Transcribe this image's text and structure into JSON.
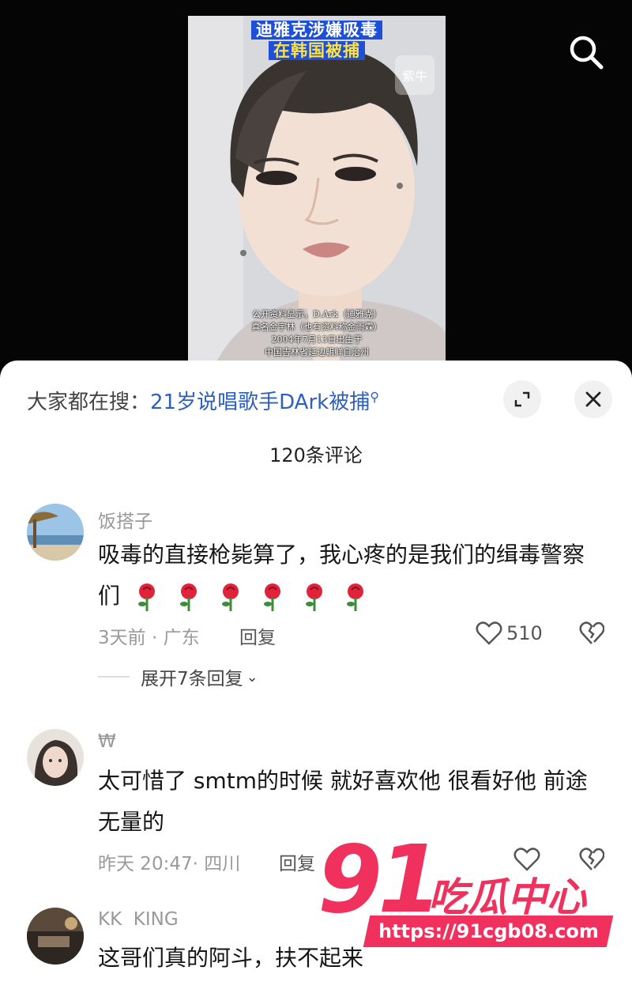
{
  "video": {
    "title_line1": "迪雅克涉嫌吸毒",
    "title_line2": "在韩国被捕",
    "logo_text": "紫牛",
    "caption_lines": [
      "公开资料显示，D.Ark（迪雅克）",
      "真名金宇林（也有资料称金雨霖）",
      "2004年7月13日出生于",
      "中国吉林省延边朝鲜自治州"
    ]
  },
  "top_bar": {
    "search_icon": "search-icon"
  },
  "search_hint": {
    "prefix": "大家都在搜：",
    "term": "21岁说唱歌手DArk被捕",
    "suffix_icon": "⚲"
  },
  "sheet_buttons": {
    "expand_icon": "expand-icon",
    "close_icon": "close-icon"
  },
  "comments_header": {
    "count_label": "120条评论"
  },
  "comments": [
    {
      "name": "饭搭子",
      "text": "吸毒的直接枪毙算了，我心疼的是我们的缉毒警察们",
      "rose_count": 6,
      "time": "3天前",
      "location": "广东",
      "reply_label": "回复",
      "likes": "510",
      "expand_label": "展开7条回复"
    },
    {
      "name": "₩",
      "text": "太可惜了 smtm的时候 就好喜欢他 很看好他 前途无量的",
      "time": "昨天 20:47",
      "location": "四川",
      "reply_label": "回复"
    },
    {
      "name": "KK  KING",
      "text": "这哥们真的阿斗，扶不起来"
    }
  ],
  "watermark": {
    "number": "91",
    "brand": "吃瓜中心",
    "url": "https://91cgb08.com"
  },
  "colors": {
    "link_blue": "#2d5fbf",
    "watermark_pink": "#f0315d",
    "rose_red": "#e0233a"
  }
}
